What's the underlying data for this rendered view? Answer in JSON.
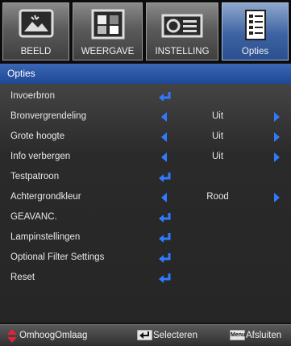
{
  "tabs": [
    {
      "label": "BEELD",
      "icon": "image-picture-icon",
      "active": false
    },
    {
      "label": "WEERGAVE",
      "icon": "display-pattern-icon",
      "active": false
    },
    {
      "label": "INSTELLING",
      "icon": "projector-icon",
      "active": false
    },
    {
      "label": "Opties",
      "icon": "checklist-icon",
      "active": true
    }
  ],
  "header": {
    "title": "Opties"
  },
  "items": [
    {
      "label": "Invoerbron",
      "type": "enter"
    },
    {
      "label": "Bronvergrendeling",
      "type": "select",
      "value": "Uit"
    },
    {
      "label": "Grote hoogte",
      "type": "select",
      "value": "Uit"
    },
    {
      "label": "Info verbergen",
      "type": "select",
      "value": "Uit"
    },
    {
      "label": "Testpatroon",
      "type": "enter"
    },
    {
      "label": "Achtergrondkleur",
      "type": "select",
      "value": "Rood"
    },
    {
      "label": "GEAVANC.",
      "type": "enter"
    },
    {
      "label": "Lampinstellingen",
      "type": "enter"
    },
    {
      "label": "Optional Filter Settings",
      "type": "enter"
    },
    {
      "label": "Reset",
      "type": "enter"
    }
  ],
  "footer": {
    "nav_label": "OmhoogOmlaag",
    "select_label": "Selecteren",
    "menu_key": "Menu",
    "exit_label": "Afsluiten"
  },
  "colors": {
    "accent": "#2f7bff",
    "header": "#2a55a3",
    "exit_arrow": "#e0223a"
  }
}
